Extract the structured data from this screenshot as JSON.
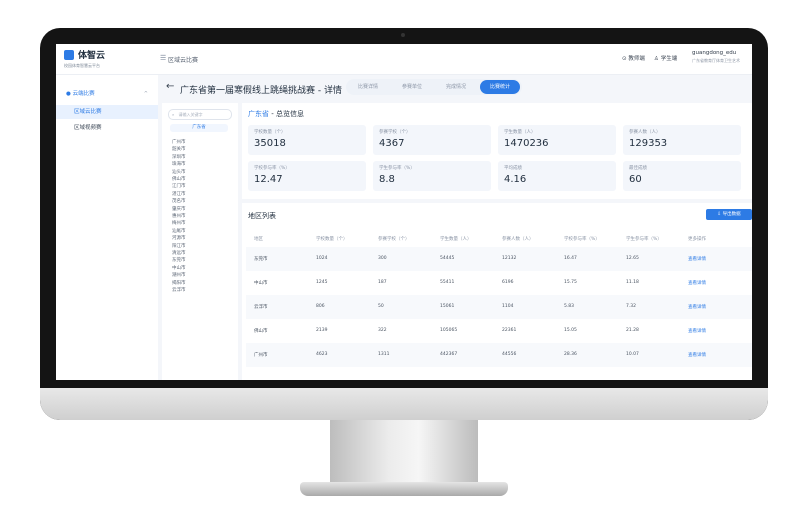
{
  "header": {
    "brand": "体智云",
    "brand_subtitle": "校园体育智慧云平台",
    "breadcrumb": "区域云比赛",
    "link_teacher": "教师端",
    "link_student": "学生端",
    "username": "guangdong_edu",
    "org": "广东省教育厅体育卫生艺术"
  },
  "sidebar": {
    "group": "云端比赛",
    "items": [
      {
        "label": "区域云比赛"
      },
      {
        "label": "区域视频赛"
      }
    ]
  },
  "page": {
    "title": "广东省第一届寒假线上跳绳挑战赛 - 详情",
    "tabs": [
      "比赛详情",
      "参赛单位",
      "完成情况",
      "比赛统计"
    ],
    "active_tab": "比赛统计"
  },
  "tree": {
    "search_placeholder": "请输入关键字",
    "root": "广东省",
    "cities": [
      "广州市",
      "韶关市",
      "深圳市",
      "珠海市",
      "汕头市",
      "佛山市",
      "江门市",
      "湛江市",
      "茂名市",
      "肇庆市",
      "惠州市",
      "梅州市",
      "汕尾市",
      "河源市",
      "阳江市",
      "清远市",
      "东莞市",
      "中山市",
      "潮州市",
      "揭阳市",
      "云浮市"
    ]
  },
  "overview": {
    "region": "广东省",
    "title_suffix": "- 总览信息",
    "stats": [
      {
        "label": "学校数量（个）",
        "value": "35018"
      },
      {
        "label": "参赛学校（个）",
        "value": "4367"
      },
      {
        "label": "学生数量（人）",
        "value": "1470236"
      },
      {
        "label": "参赛人数（人）",
        "value": "129353"
      },
      {
        "label": "学校参与率（%）",
        "value": "12.47"
      },
      {
        "label": "学生参与率（%）",
        "value": "8.8"
      },
      {
        "label": "平均成绩",
        "value": "4.16"
      },
      {
        "label": "最佳成绩",
        "value": "60"
      }
    ]
  },
  "table": {
    "title": "地区列表",
    "export_label": "导出数据",
    "headers": [
      "地区",
      "学校数量（个）",
      "参赛学校（个）",
      "学生数量（人）",
      "参赛人数（人）",
      "学校参与率（%）",
      "学生参与率（%）",
      "更多操作"
    ],
    "rows": [
      [
        "东莞市",
        "1024",
        "300",
        "54445",
        "12132",
        "16.47",
        "12.65",
        "查看详情"
      ],
      [
        "中山市",
        "1245",
        "187",
        "55411",
        "6196",
        "15.75",
        "11.18",
        "查看详情"
      ],
      [
        "云浮市",
        "806",
        "50",
        "15061",
        "1104",
        "5.83",
        "7.32",
        "查看详情"
      ],
      [
        "佛山市",
        "2139",
        "322",
        "105065",
        "22361",
        "15.05",
        "21.28",
        "查看详情"
      ],
      [
        "广州市",
        "4623",
        "1311",
        "442367",
        "44556",
        "28.36",
        "10.07",
        "查看详情"
      ]
    ]
  },
  "colors": {
    "accent": "#2d7be5",
    "background": "#f4f6fa"
  }
}
